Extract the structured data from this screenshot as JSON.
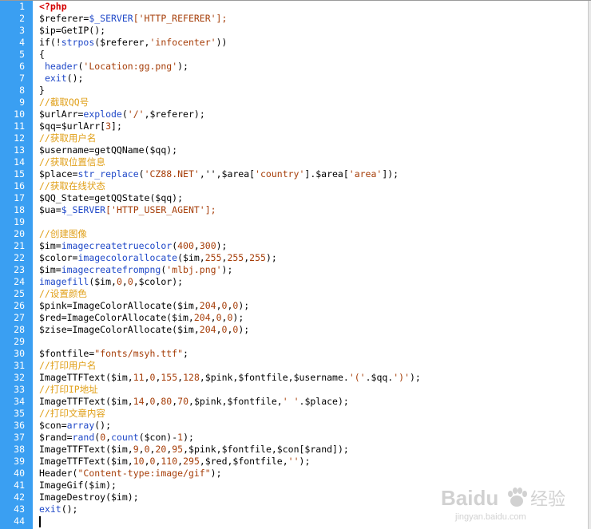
{
  "editor": {
    "line_numbers": [
      "1",
      "2",
      "3",
      "4",
      "5",
      "6",
      "7",
      "8",
      "9",
      "10",
      "11",
      "12",
      "13",
      "14",
      "15",
      "16",
      "17",
      "18",
      "19",
      "20",
      "21",
      "22",
      "23",
      "24",
      "25",
      "26",
      "27",
      "28",
      "29",
      "30",
      "31",
      "32",
      "33",
      "34",
      "35",
      "36",
      "37",
      "38",
      "39",
      "40",
      "41",
      "42",
      "43",
      "44"
    ],
    "lines": [
      [
        {
          "t": "<?php",
          "c": "php"
        }
      ],
      [
        {
          "t": "$referer=",
          "c": ""
        },
        {
          "t": "$_SERVER",
          "c": "fn"
        },
        {
          "t": "['HTTP_REFERER'];",
          "c": "str"
        }
      ],
      [
        {
          "t": "$ip=GetIP();",
          "c": ""
        }
      ],
      [
        {
          "t": "if(!",
          "c": ""
        },
        {
          "t": "strpos",
          "c": "fn"
        },
        {
          "t": "($referer,",
          "c": ""
        },
        {
          "t": "'infocenter'",
          "c": "str"
        },
        {
          "t": "))",
          "c": ""
        }
      ],
      [
        {
          "t": "{",
          "c": ""
        }
      ],
      [
        {
          "t": " ",
          "c": ""
        },
        {
          "t": "header",
          "c": "fn"
        },
        {
          "t": "(",
          "c": ""
        },
        {
          "t": "'Location:gg.png'",
          "c": "str"
        },
        {
          "t": ");",
          "c": ""
        }
      ],
      [
        {
          "t": " ",
          "c": ""
        },
        {
          "t": "exit",
          "c": "fn"
        },
        {
          "t": "();",
          "c": ""
        }
      ],
      [
        {
          "t": "}",
          "c": ""
        }
      ],
      [
        {
          "t": "//截取QQ号",
          "c": "comment"
        }
      ],
      [
        {
          "t": "$urlArr=",
          "c": ""
        },
        {
          "t": "explode",
          "c": "fn"
        },
        {
          "t": "(",
          "c": ""
        },
        {
          "t": "'/'",
          "c": "str"
        },
        {
          "t": ",$referer);",
          "c": ""
        }
      ],
      [
        {
          "t": "$qq=$urlArr[",
          "c": ""
        },
        {
          "t": "3",
          "c": "str"
        },
        {
          "t": "];",
          "c": ""
        }
      ],
      [
        {
          "t": "//获取用户名",
          "c": "comment"
        }
      ],
      [
        {
          "t": "$username=getQQName($qq);",
          "c": ""
        }
      ],
      [
        {
          "t": "//获取位置信息",
          "c": "comment"
        }
      ],
      [
        {
          "t": "$place=",
          "c": ""
        },
        {
          "t": "str_replace",
          "c": "fn"
        },
        {
          "t": "(",
          "c": ""
        },
        {
          "t": "'CZ88.NET'",
          "c": "str"
        },
        {
          "t": ",'',$area[",
          "c": ""
        },
        {
          "t": "'country'",
          "c": "str"
        },
        {
          "t": "].$area[",
          "c": ""
        },
        {
          "t": "'area'",
          "c": "str"
        },
        {
          "t": "]);",
          "c": ""
        }
      ],
      [
        {
          "t": "//获取在线状态",
          "c": "comment"
        }
      ],
      [
        {
          "t": "$QQ_State=getQQState($qq);",
          "c": ""
        }
      ],
      [
        {
          "t": "$ua=",
          "c": ""
        },
        {
          "t": "$_SERVER",
          "c": "fn"
        },
        {
          "t": "['HTTP_USER_AGENT'];",
          "c": "str"
        }
      ],
      [
        {
          "t": "",
          "c": ""
        }
      ],
      [
        {
          "t": "//创建图像",
          "c": "comment"
        }
      ],
      [
        {
          "t": "$im=",
          "c": ""
        },
        {
          "t": "imagecreatetruecolor",
          "c": "fn"
        },
        {
          "t": "(",
          "c": ""
        },
        {
          "t": "400",
          "c": "str"
        },
        {
          "t": ",",
          "c": ""
        },
        {
          "t": "300",
          "c": "str"
        },
        {
          "t": ");",
          "c": ""
        }
      ],
      [
        {
          "t": "$color=",
          "c": ""
        },
        {
          "t": "imagecolorallocate",
          "c": "fn"
        },
        {
          "t": "($im,",
          "c": ""
        },
        {
          "t": "255",
          "c": "str"
        },
        {
          "t": ",",
          "c": ""
        },
        {
          "t": "255",
          "c": "str"
        },
        {
          "t": ",",
          "c": ""
        },
        {
          "t": "255",
          "c": "str"
        },
        {
          "t": ");",
          "c": ""
        }
      ],
      [
        {
          "t": "$im=",
          "c": ""
        },
        {
          "t": "imagecreatefrompng",
          "c": "fn"
        },
        {
          "t": "(",
          "c": ""
        },
        {
          "t": "'mlbj.png'",
          "c": "str"
        },
        {
          "t": ");",
          "c": ""
        }
      ],
      [
        {
          "t": "imagefill",
          "c": "fn"
        },
        {
          "t": "($im,",
          "c": ""
        },
        {
          "t": "0",
          "c": "str"
        },
        {
          "t": ",",
          "c": ""
        },
        {
          "t": "0",
          "c": "str"
        },
        {
          "t": ",$color);",
          "c": ""
        }
      ],
      [
        {
          "t": "//设置颜色",
          "c": "comment"
        }
      ],
      [
        {
          "t": "$pink=ImageColorAllocate($im,",
          "c": ""
        },
        {
          "t": "204",
          "c": "str"
        },
        {
          "t": ",",
          "c": ""
        },
        {
          "t": "0",
          "c": "str"
        },
        {
          "t": ",",
          "c": ""
        },
        {
          "t": "0",
          "c": "str"
        },
        {
          "t": ");",
          "c": ""
        }
      ],
      [
        {
          "t": "$red=ImageColorAllocate($im,",
          "c": ""
        },
        {
          "t": "204",
          "c": "str"
        },
        {
          "t": ",",
          "c": ""
        },
        {
          "t": "0",
          "c": "str"
        },
        {
          "t": ",",
          "c": ""
        },
        {
          "t": "0",
          "c": "str"
        },
        {
          "t": ");",
          "c": ""
        }
      ],
      [
        {
          "t": "$zise=ImageColorAllocate($im,",
          "c": ""
        },
        {
          "t": "204",
          "c": "str"
        },
        {
          "t": ",",
          "c": ""
        },
        {
          "t": "0",
          "c": "str"
        },
        {
          "t": ",",
          "c": ""
        },
        {
          "t": "0",
          "c": "str"
        },
        {
          "t": ");",
          "c": ""
        }
      ],
      [
        {
          "t": "",
          "c": ""
        }
      ],
      [
        {
          "t": "$fontfile=",
          "c": ""
        },
        {
          "t": "\"fonts/msyh.ttf\"",
          "c": "str"
        },
        {
          "t": ";",
          "c": ""
        }
      ],
      [
        {
          "t": "//打印用户名",
          "c": "comment"
        }
      ],
      [
        {
          "t": "ImageTTFText($im,",
          "c": ""
        },
        {
          "t": "11",
          "c": "str"
        },
        {
          "t": ",",
          "c": ""
        },
        {
          "t": "0",
          "c": "str"
        },
        {
          "t": ",",
          "c": ""
        },
        {
          "t": "155",
          "c": "str"
        },
        {
          "t": ",",
          "c": ""
        },
        {
          "t": "128",
          "c": "str"
        },
        {
          "t": ",$pink,$fontfile,$username.",
          "c": ""
        },
        {
          "t": "'('",
          "c": "str"
        },
        {
          "t": ".$qq.",
          "c": ""
        },
        {
          "t": "')'",
          "c": "str"
        },
        {
          "t": ");",
          "c": ""
        }
      ],
      [
        {
          "t": "//打印IP地址",
          "c": "comment"
        }
      ],
      [
        {
          "t": "ImageTTFText($im,",
          "c": ""
        },
        {
          "t": "14",
          "c": "str"
        },
        {
          "t": ",",
          "c": ""
        },
        {
          "t": "0",
          "c": "str"
        },
        {
          "t": ",",
          "c": ""
        },
        {
          "t": "80",
          "c": "str"
        },
        {
          "t": ",",
          "c": ""
        },
        {
          "t": "70",
          "c": "str"
        },
        {
          "t": ",$pink,$fontfile,",
          "c": ""
        },
        {
          "t": "' '",
          "c": "str"
        },
        {
          "t": ".$place);",
          "c": ""
        }
      ],
      [
        {
          "t": "//打印文章内容",
          "c": "comment"
        }
      ],
      [
        {
          "t": "$con=",
          "c": ""
        },
        {
          "t": "array",
          "c": "fn"
        },
        {
          "t": "();",
          "c": ""
        }
      ],
      [
        {
          "t": "$rand=",
          "c": ""
        },
        {
          "t": "rand",
          "c": "fn"
        },
        {
          "t": "(",
          "c": ""
        },
        {
          "t": "0",
          "c": "str"
        },
        {
          "t": ",",
          "c": ""
        },
        {
          "t": "count",
          "c": "fn"
        },
        {
          "t": "($con)-",
          "c": ""
        },
        {
          "t": "1",
          "c": "str"
        },
        {
          "t": ");",
          "c": ""
        }
      ],
      [
        {
          "t": "ImageTTFText($im,",
          "c": ""
        },
        {
          "t": "9",
          "c": "str"
        },
        {
          "t": ",",
          "c": ""
        },
        {
          "t": "0",
          "c": "str"
        },
        {
          "t": ",",
          "c": ""
        },
        {
          "t": "20",
          "c": "str"
        },
        {
          "t": ",",
          "c": ""
        },
        {
          "t": "95",
          "c": "str"
        },
        {
          "t": ",$pink,$fontfile,$con[$rand]);",
          "c": ""
        }
      ],
      [
        {
          "t": "ImageTTFText($im,",
          "c": ""
        },
        {
          "t": "10",
          "c": "str"
        },
        {
          "t": ",",
          "c": ""
        },
        {
          "t": "0",
          "c": "str"
        },
        {
          "t": ",",
          "c": ""
        },
        {
          "t": "110",
          "c": "str"
        },
        {
          "t": ",",
          "c": ""
        },
        {
          "t": "295",
          "c": "str"
        },
        {
          "t": ",$red,$fontfile,",
          "c": ""
        },
        {
          "t": "''",
          "c": "str"
        },
        {
          "t": ");",
          "c": ""
        }
      ],
      [
        {
          "t": "Header(",
          "c": ""
        },
        {
          "t": "\"Content-type:image/gif\"",
          "c": "str"
        },
        {
          "t": ");",
          "c": ""
        }
      ],
      [
        {
          "t": "ImageGif($im);",
          "c": ""
        }
      ],
      [
        {
          "t": "ImageDestroy($im);",
          "c": ""
        }
      ],
      [
        {
          "t": "exit",
          "c": "fn"
        },
        {
          "t": "();",
          "c": ""
        }
      ],
      [
        {
          "t": "",
          "c": ""
        }
      ]
    ]
  },
  "watermark": {
    "brand": "Baidu",
    "brand_cn": "经验",
    "url": "jingyan.baidu.com"
  }
}
